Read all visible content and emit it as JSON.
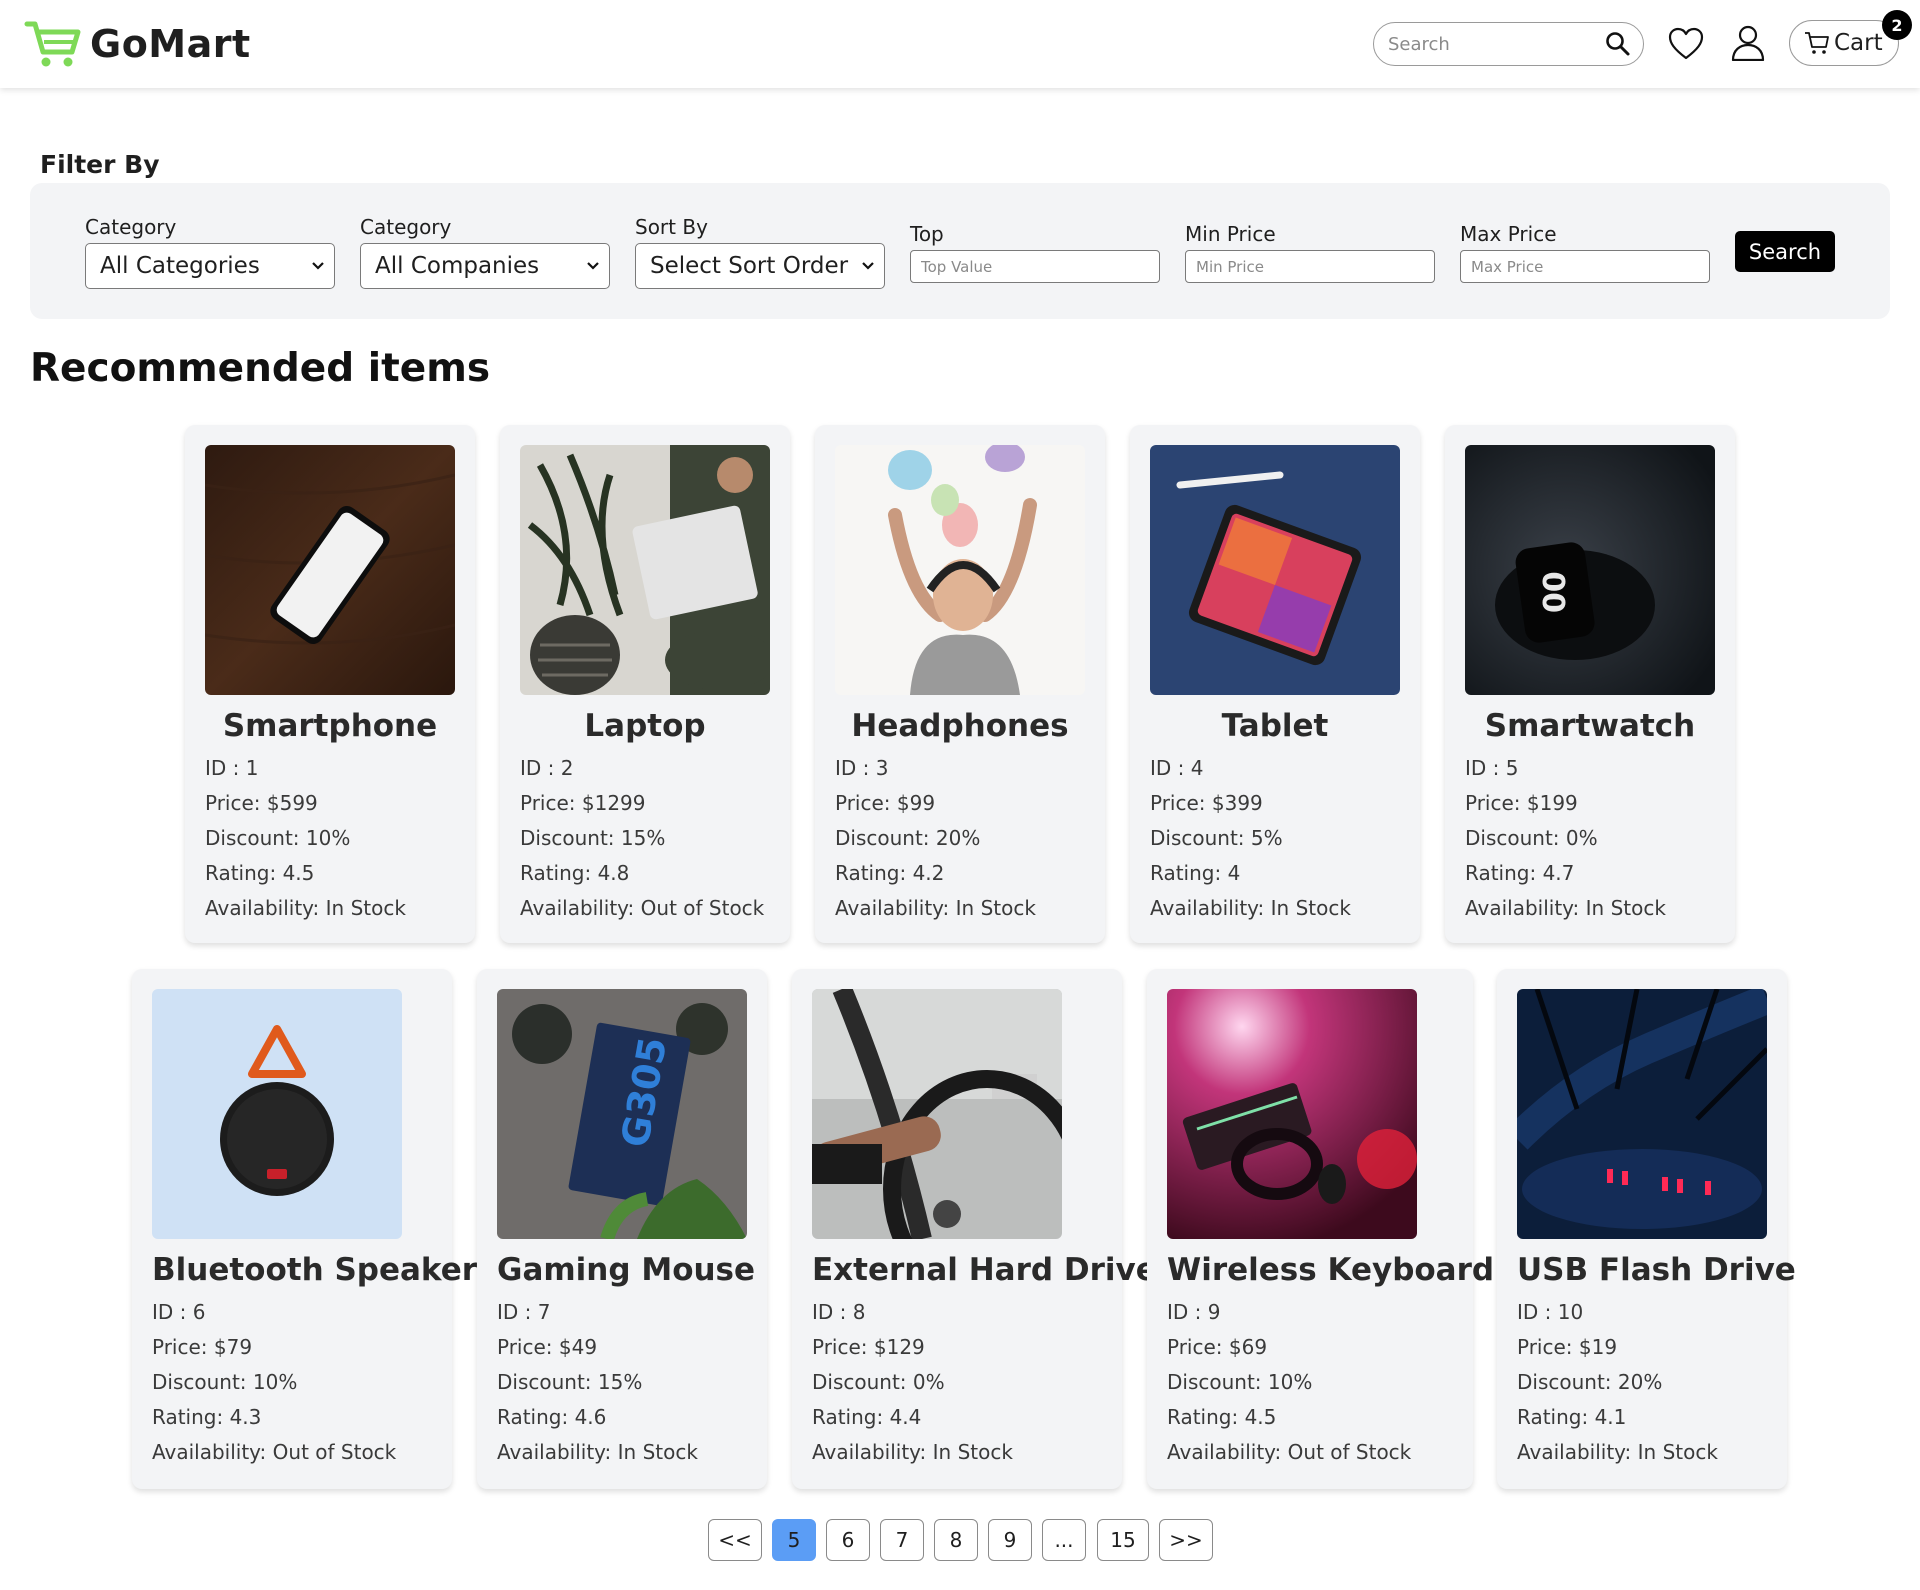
{
  "header": {
    "brand": "GoMart",
    "search_placeholder": "Search",
    "cart_label": "Cart",
    "cart_count": "2"
  },
  "filter": {
    "title": "Filter By",
    "category_label": "Category",
    "category_value": "All Categories",
    "company_label": "Category",
    "company_value": "All Companies",
    "sort_label": "Sort By",
    "sort_value": "Select Sort Order",
    "top_label": "Top",
    "top_placeholder": "Top Value",
    "min_label": "Min Price",
    "min_placeholder": "Min Price",
    "max_label": "Max Price",
    "max_placeholder": "Max Price",
    "search_button": "Search"
  },
  "section_title": "Recommended items",
  "products": [
    {
      "name": "Smartphone",
      "id": "ID : 1",
      "price": "Price: $599",
      "discount": "Discount: 10%",
      "rating": "Rating: 4.5",
      "availability": "Availability: In Stock",
      "image_icon": "smartphone-image"
    },
    {
      "name": "Laptop",
      "id": "ID : 2",
      "price": "Price: $1299",
      "discount": "Discount: 15%",
      "rating": "Rating: 4.8",
      "availability": "Availability: Out of Stock",
      "image_icon": "laptop-image"
    },
    {
      "name": "Headphones",
      "id": "ID : 3",
      "price": "Price: $99",
      "discount": "Discount: 20%",
      "rating": "Rating: 4.2",
      "availability": "Availability: In Stock",
      "image_icon": "headphones-image"
    },
    {
      "name": "Tablet",
      "id": "ID : 4",
      "price": "Price: $399",
      "discount": "Discount: 5%",
      "rating": "Rating: 4",
      "availability": "Availability: In Stock",
      "image_icon": "tablet-image"
    },
    {
      "name": "Smartwatch",
      "id": "ID : 5",
      "price": "Price: $199",
      "discount": "Discount: 0%",
      "rating": "Rating: 4.7",
      "availability": "Availability: In Stock",
      "image_icon": "smartwatch-image"
    },
    {
      "name": "Bluetooth Speaker",
      "id": "ID : 6",
      "price": "Price: $79",
      "discount": "Discount: 10%",
      "rating": "Rating: 4.3",
      "availability": "Availability: Out of Stock",
      "image_icon": "speaker-image"
    },
    {
      "name": "Gaming Mouse",
      "id": "ID : 7",
      "price": "Price: $49",
      "discount": "Discount: 15%",
      "rating": "Rating: 4.6",
      "availability": "Availability: In Stock",
      "image_icon": "mouse-box-image"
    },
    {
      "name": "External Hard Drive",
      "id": "ID : 8",
      "price": "Price: $129",
      "discount": "Discount: 0%",
      "rating": "Rating: 4.4",
      "availability": "Availability: In Stock",
      "image_icon": "steering-wheel-image"
    },
    {
      "name": "Wireless Keyboard",
      "id": "ID : 9",
      "price": "Price: $69",
      "discount": "Discount: 10%",
      "rating": "Rating: 4.5",
      "availability": "Availability: Out of Stock",
      "image_icon": "keyboard-setup-image"
    },
    {
      "name": "USB Flash Drive",
      "id": "ID : 10",
      "price": "Price: $19",
      "discount": "Discount: 20%",
      "rating": "Rating: 4.1",
      "availability": "Availability: In Stock",
      "image_icon": "night-scene-image"
    }
  ],
  "pagination": {
    "prev": "<<",
    "pages": [
      "5",
      "6",
      "7",
      "8",
      "9",
      "...",
      "15"
    ],
    "active": "5",
    "next": ">>"
  },
  "colors": {
    "brand_green": "#7ed957",
    "active_page": "#5b9df5",
    "panel_bg": "#f3f4f6"
  }
}
